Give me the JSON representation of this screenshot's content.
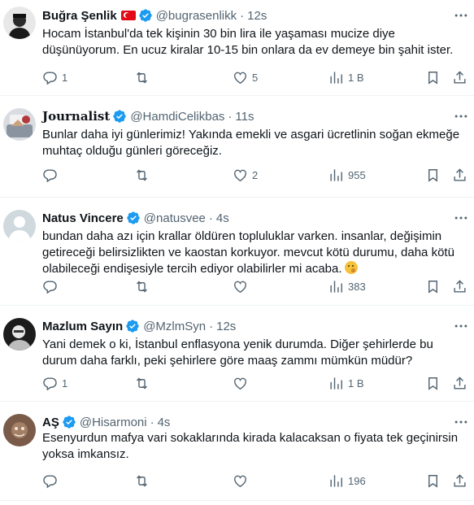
{
  "tweets": [
    {
      "name": "Buğra Şenlik",
      "has_flag": true,
      "handle": "@bugrasenlikk",
      "dot": "·",
      "time": "12s",
      "text": "Hocam İstanbul'da tek kişinin 30 bin lira ile yaşaması mucize diye düşünüyorum. En ucuz kiralar 10-15 bin onlara da ev demeye bin şahit ister.",
      "replies": "1",
      "retweets": "",
      "likes": "5",
      "views": "1 B"
    },
    {
      "name": "Journalist",
      "handle": "@HamdiCelikbas",
      "dot": "·",
      "time": "11s",
      "text": "Bunlar daha iyi günlerimiz! Yakında emekli ve asgari ücretlinin soğan ekmeğe muhtaç olduğu günleri göreceğiz.",
      "replies": "",
      "retweets": "",
      "likes": "2",
      "views": "955"
    },
    {
      "name": "Natus Vincere",
      "handle": "@natusvee",
      "dot": "·",
      "time": "4s",
      "text": "bundan daha azı için krallar öldüren topluluklar varken. insanlar, değişimin getireceği belirsizlikten ve kaostan korkuyor. mevcut kötü durumu, daha kötü olabileceği endişesiyle tercih ediyor olabilirler mi acaba.",
      "replies": "",
      "retweets": "",
      "likes": "",
      "views": "383"
    },
    {
      "name": "Mazlum Sayın",
      "handle": "@MzlmSyn",
      "dot": "·",
      "time": "12s",
      "text": "Yani demek o ki, İstanbul enflasyona yenik durumda. Diğer şehirlerde bu durum daha farklı, peki şehirlere göre maaş zammı mümkün müdür?",
      "replies": "1",
      "retweets": "",
      "likes": "",
      "views": "1 B"
    },
    {
      "name": "AŞ",
      "handle": "@Hisarmoni",
      "dot": "·",
      "time": "4s",
      "text": "Esenyurdun mafya vari sokaklarında kirada kalacaksan o fiyata tek geçinirsin yoksa imkansız.",
      "replies": "",
      "retweets": "",
      "likes": "",
      "views": "196"
    }
  ],
  "colors": {
    "text": "#0f1419",
    "muted": "#536471",
    "verified": "#1d9bf0",
    "divider": "#eff3f4"
  }
}
